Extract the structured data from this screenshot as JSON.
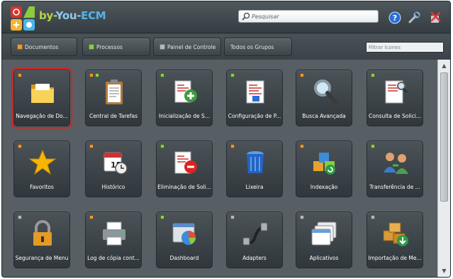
{
  "app": {
    "logo_parts": [
      "by-",
      "You-",
      "ECM"
    ]
  },
  "search": {
    "placeholder": "Pesquisar",
    "icon": "magnifier-icon"
  },
  "header_icons": [
    "help-icon",
    "tools-icon",
    "logout-icon"
  ],
  "toolbar": {
    "buttons": [
      {
        "label": "Documentos",
        "color": "#e89a3c"
      },
      {
        "label": "Processos",
        "color": "#8ccc4c"
      },
      {
        "label": "Painel de Controle",
        "color": "#b5b9bb"
      },
      {
        "label": "Todos os Grupos",
        "color": ""
      }
    ],
    "filter_placeholder": "Filtrar Ícones"
  },
  "tiles": [
    {
      "label": "Navegação de Do...",
      "icon": "folder-icon",
      "dots": [
        "#e89a3c"
      ],
      "selected": true
    },
    {
      "label": "Central de Tarefas",
      "icon": "clipboard-icon",
      "dots": [
        "#e89a3c",
        "#8ccc4c"
      ]
    },
    {
      "label": "Inicialização de S...",
      "icon": "document-add-icon",
      "dots": [
        "#8ccc4c"
      ]
    },
    {
      "label": "Configuração de P...",
      "icon": "document-config-icon",
      "dots": [
        "#8ccc4c"
      ]
    },
    {
      "label": "Busca Avançada",
      "icon": "magnifier-icon",
      "dots": [
        "#e89a3c"
      ]
    },
    {
      "label": "Consulta de Solici...",
      "icon": "document-search-icon",
      "dots": [
        "#8ccc4c"
      ]
    },
    {
      "label": "Favoritos",
      "icon": "star-icon",
      "dots": [
        "#e89a3c"
      ]
    },
    {
      "label": "Histórico",
      "icon": "calendar-clock-icon",
      "dots": [
        "#e89a3c"
      ]
    },
    {
      "label": "Eliminação de Soli...",
      "icon": "document-remove-icon",
      "dots": [
        "#8ccc4c"
      ]
    },
    {
      "label": "Lixeira",
      "icon": "trash-icon",
      "dots": [
        "#e89a3c"
      ]
    },
    {
      "label": "Indexação",
      "icon": "cubes-icon",
      "dots": [
        "#e89a3c"
      ]
    },
    {
      "label": "Transferência de ...",
      "icon": "users-transfer-icon",
      "dots": [
        "#8ccc4c"
      ]
    },
    {
      "label": "Segurança de Menu",
      "icon": "padlock-icon",
      "dots": [
        "#b5b9bb"
      ]
    },
    {
      "label": "Log de cópia cont...",
      "icon": "printer-icon",
      "dots": [
        "#e89a3c"
      ]
    },
    {
      "label": "Dashboard",
      "icon": "dashboard-chart-icon",
      "dots": [
        "#8ccc4c"
      ]
    },
    {
      "label": "Adapters",
      "icon": "usb-cable-icon",
      "dots": [
        "#b5b9bb"
      ]
    },
    {
      "label": "Aplicativos",
      "icon": "windows-icon",
      "dots": [
        "#b5b9bb"
      ]
    },
    {
      "label": "Importação de Me...",
      "icon": "boxes-import-icon",
      "dots": [
        "#b5b9bb"
      ]
    }
  ],
  "colors": {
    "selection": "#e11d1d",
    "background": "#575f64"
  }
}
